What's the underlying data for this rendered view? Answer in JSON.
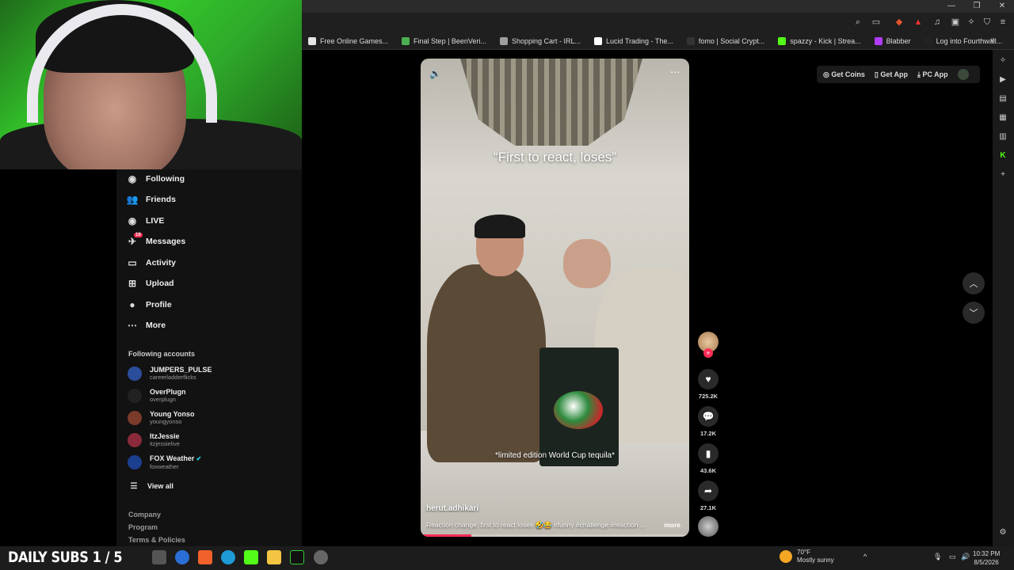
{
  "overlay": {
    "stream_banner": "DAILY SUBS 1 / 5"
  },
  "bookmarks": [
    {
      "label": "Free Online Games...",
      "color": "#e5e5e5"
    },
    {
      "label": "Final Step | BeenVeri...",
      "color": "#4caf50"
    },
    {
      "label": "Shopping Cart - IRL...",
      "color": "#9e9e9e"
    },
    {
      "label": "Lucid Trading - The...",
      "color": "#ffffff"
    },
    {
      "label": "fomo | Social Crypt...",
      "color": "#333333"
    },
    {
      "label": "spazzy - Kick | Strea...",
      "color": "#53fc18"
    },
    {
      "label": "Blabber",
      "color": "#b23cfd"
    },
    {
      "label": "Log into Fourthwall...",
      "color": "#222222"
    }
  ],
  "sidebar": {
    "nav": [
      {
        "label": "Following",
        "icon": "following-avatar-icon"
      },
      {
        "label": "Friends",
        "icon": "friends-icon"
      },
      {
        "label": "LIVE",
        "icon": "live-icon"
      },
      {
        "label": "Messages",
        "icon": "messages-icon",
        "badge": "19"
      },
      {
        "label": "Activity",
        "icon": "activity-icon"
      },
      {
        "label": "Upload",
        "icon": "upload-icon"
      },
      {
        "label": "Profile",
        "icon": "profile-icon"
      },
      {
        "label": "More",
        "icon": "more-icon"
      }
    ],
    "following_title": "Following accounts",
    "accounts": [
      {
        "name": "JUMPERS_PULSE",
        "handle": "careerladderflicks",
        "color": "#2a4d9c"
      },
      {
        "name": "OverPlugn",
        "handle": "overplugn",
        "color": "#222222"
      },
      {
        "name": "Young Yonso",
        "handle": "youngyonso",
        "color": "#7a3b2a"
      },
      {
        "name": "ItzJessie",
        "handle": "itzjessielive",
        "color": "#8a2a3a"
      },
      {
        "name": "FOX Weather",
        "handle": "foxweather",
        "color": "#1d3f8f",
        "verified": true
      }
    ],
    "view_all": "View all",
    "footer": [
      "Company",
      "Program",
      "Terms & Policies"
    ]
  },
  "video": {
    "caption_top": "“First to react, loses”",
    "caption_bottom": "*limited edition World Cup tequila*",
    "author": "herut.adhikari",
    "description": "Reaction change: first to react loses 🤣😂 #funny #challenge #reaction ...",
    "more_label": "more",
    "progress": 0.19
  },
  "actions": {
    "likes": "725.2K",
    "comments": "17.2K",
    "saves": "43.6K",
    "shares": "27.1K"
  },
  "topbar": {
    "get_coins": "Get Coins",
    "get_app": "Get App",
    "pc_app": "PC App"
  },
  "taskbar": {
    "temperature": "70°F",
    "weather": "Mostly sunny",
    "time": "10:32 PM",
    "date": "8/5/2026"
  }
}
